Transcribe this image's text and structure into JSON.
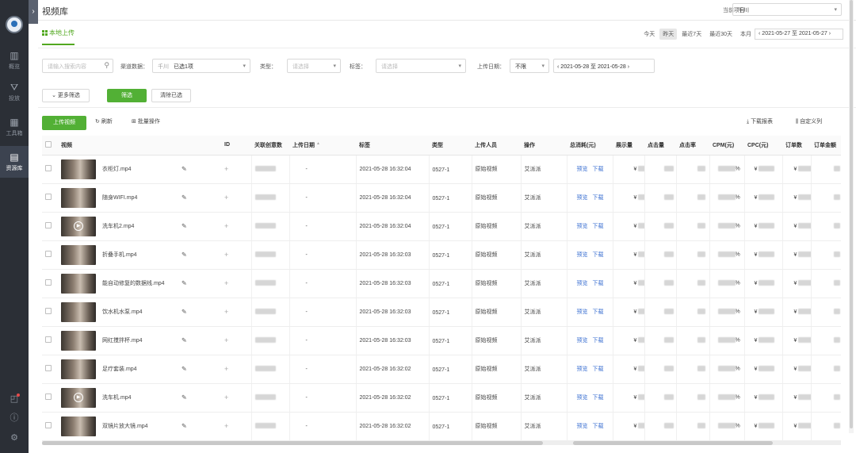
{
  "header": {
    "title": "视频库",
    "project_label": "当前项目",
    "project_value": "千川"
  },
  "tabs": {
    "local_upload": "本地上传",
    "quick_ranges": [
      "今天",
      "昨天",
      "最近7天",
      "最近30天",
      "本月"
    ],
    "active_range": "昨天",
    "date_range": "2021-05-27 至 2021-05-27"
  },
  "filters": {
    "search_placeholder": "请输入搜索内容",
    "channel_label": "渠道数据：",
    "channel_tag": "千川",
    "channel_value": "已选1项",
    "type_label": "类型：",
    "type_placeholder": "请选择",
    "tag_label": "标签：",
    "tag_placeholder": "请选择",
    "upload_date_label": "上传日期：",
    "upload_date_value": "不限",
    "upload_date_range": "2021-05-28 至 2021-05-28"
  },
  "actions": {
    "more_filters": "更多筛选",
    "filter": "筛选",
    "clear": "清除已选"
  },
  "toolbar": {
    "upload": "上传视频",
    "refresh": "刷新",
    "batch": "批量操作",
    "download": "下载报表",
    "custom_columns": "自定义列"
  },
  "table": {
    "columns": [
      "视频",
      "ID",
      "关联创意数",
      "上传日期",
      "标签",
      "类型",
      "上传人员",
      "操作",
      "总消耗(元)",
      "展示量",
      "点击量",
      "点击率",
      "CPM(元)",
      "CPC(元)",
      "订单数",
      "订单金额"
    ],
    "op_preview": "预览",
    "op_download": "下载",
    "dash": "-",
    "yen": "¥",
    "percent": "%",
    "rows": [
      {
        "name": "衣柜灯.mp4",
        "date": "2021-05-28 16:32:04",
        "tag": "0527-1",
        "type": "原始视频",
        "uploader": "艾派派",
        "play": false
      },
      {
        "name": "随身WIFI.mp4",
        "date": "2021-05-28 16:32:04",
        "tag": "0527-1",
        "type": "原始视频",
        "uploader": "艾派派",
        "play": false
      },
      {
        "name": "洗车机2.mp4",
        "date": "2021-05-28 16:32:04",
        "tag": "0527-1",
        "type": "原始视频",
        "uploader": "艾派派",
        "play": true
      },
      {
        "name": "折叠手机.mp4",
        "date": "2021-05-28 16:32:03",
        "tag": "0527-1",
        "type": "原始视频",
        "uploader": "艾派派",
        "play": false
      },
      {
        "name": "能自动修复的数据线.mp4",
        "date": "2021-05-28 16:32:03",
        "tag": "0527-1",
        "type": "原始视频",
        "uploader": "艾派派",
        "play": false
      },
      {
        "name": "饮水机水泵.mp4",
        "date": "2021-05-28 16:32:03",
        "tag": "0527-1",
        "type": "原始视频",
        "uploader": "艾派派",
        "play": false
      },
      {
        "name": "网红搅拌杯.mp4",
        "date": "2021-05-28 16:32:03",
        "tag": "0527-1",
        "type": "原始视频",
        "uploader": "艾派派",
        "play": false
      },
      {
        "name": "足疗套装.mp4",
        "date": "2021-05-28 16:32:02",
        "tag": "0527-1",
        "type": "原始视频",
        "uploader": "艾派派",
        "play": false
      },
      {
        "name": "洗车机.mp4",
        "date": "2021-05-28 16:32:02",
        "tag": "0527-1",
        "type": "原始视频",
        "uploader": "艾派派",
        "play": true
      },
      {
        "name": "双镜片放大镜.mp4",
        "date": "2021-05-28 16:32:02",
        "tag": "0527-1",
        "type": "原始视频",
        "uploader": "艾派派",
        "play": false
      }
    ]
  },
  "sidebar": {
    "items": [
      {
        "label": "概览",
        "icon": "chart-icon"
      },
      {
        "label": "投放",
        "icon": "send-icon"
      },
      {
        "label": "工具箱",
        "icon": "grid-icon"
      },
      {
        "label": "资源库",
        "icon": "library-icon"
      }
    ],
    "active": "资源库"
  },
  "colors": {
    "accent": "#52b035",
    "rail": "#2b2f36",
    "link": "#3a6fd1"
  }
}
